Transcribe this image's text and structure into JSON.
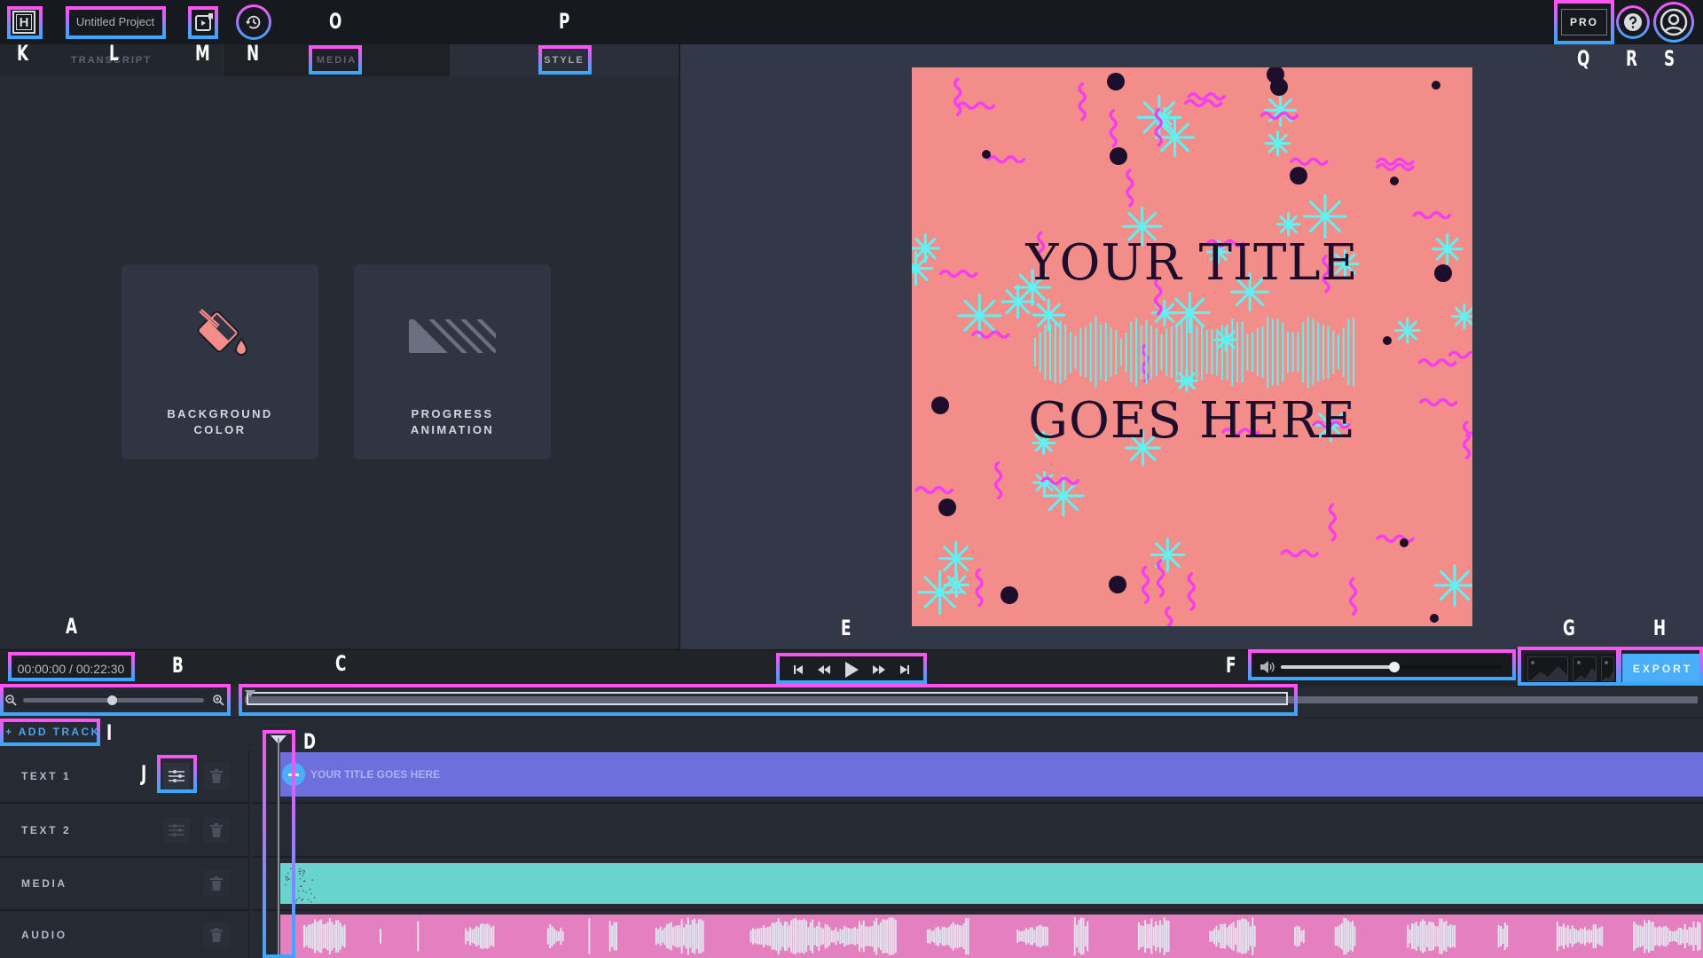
{
  "header": {
    "logo_letter": "H",
    "project_name": "Untitled Project",
    "icons": [
      "logo-icon",
      "video-preview-icon",
      "history-icon"
    ],
    "pro_label": "PRO",
    "help_icon": "help-icon",
    "account_icon": "user-avatar-icon"
  },
  "tabs": [
    {
      "label": "TRANSCRIPT",
      "active": false
    },
    {
      "label": "MEDIA",
      "active": false
    },
    {
      "label": "STYLE",
      "active": true
    }
  ],
  "style_panel": {
    "cards": [
      {
        "label": "BACKGROUND\nCOLOR",
        "icon": "paint-bucket-icon",
        "icon_color": "#f38d8a"
      },
      {
        "label": "PROGRESS\nANIMATION",
        "icon": "progress-stripes-icon",
        "icon_color": "#6a7080"
      }
    ]
  },
  "preview": {
    "background_color": "#f38d8a",
    "title_line1": "YOUR TITLE",
    "title_line2": "GOES HERE",
    "waveform_color": "#5ef2f2",
    "accent_colors": {
      "squiggle": "#f53ef0",
      "star": "#5ef2f2",
      "dot": "#1d0f2c"
    }
  },
  "controls": {
    "time_display": "00:00:00 / 00:22:30",
    "transport": [
      "skip-to-start-icon",
      "rewind-icon",
      "play-icon",
      "fast-forward-icon",
      "skip-to-end-icon"
    ],
    "volume_percent": 51,
    "aspect_ratios": [
      "landscape",
      "square",
      "portrait"
    ],
    "export_label": "EXPORT"
  },
  "timeline": {
    "zoom_percent": 49,
    "add_track_label": "+ ADD TRACK",
    "tracks": [
      {
        "label": "TEXT 1",
        "type": "text",
        "clip_text": "YOUR TITLE GOES HERE",
        "has_settings": true,
        "settings_active": true
      },
      {
        "label": "TEXT 2",
        "type": "empty",
        "clip_text": "",
        "has_settings": true,
        "settings_active": false
      },
      {
        "label": "MEDIA",
        "type": "media",
        "clip_text": "",
        "has_settings": false
      },
      {
        "label": "AUDIO",
        "type": "audio",
        "clip_text": "",
        "has_settings": false
      }
    ],
    "clip_colors": {
      "text": "#6c6fdc",
      "media": "#69d4ce",
      "audio": "#e47fc0"
    }
  },
  "annotations": {
    "A": "A",
    "B": "B",
    "C": "C",
    "D": "D",
    "E": "E",
    "F": "F",
    "G": "G",
    "H": "H",
    "I": "I",
    "J": "J",
    "K": "K",
    "L": "L",
    "M": "M",
    "N": "N",
    "O": "O",
    "P": "P",
    "Q": "Q",
    "R": "R",
    "S": "S"
  }
}
